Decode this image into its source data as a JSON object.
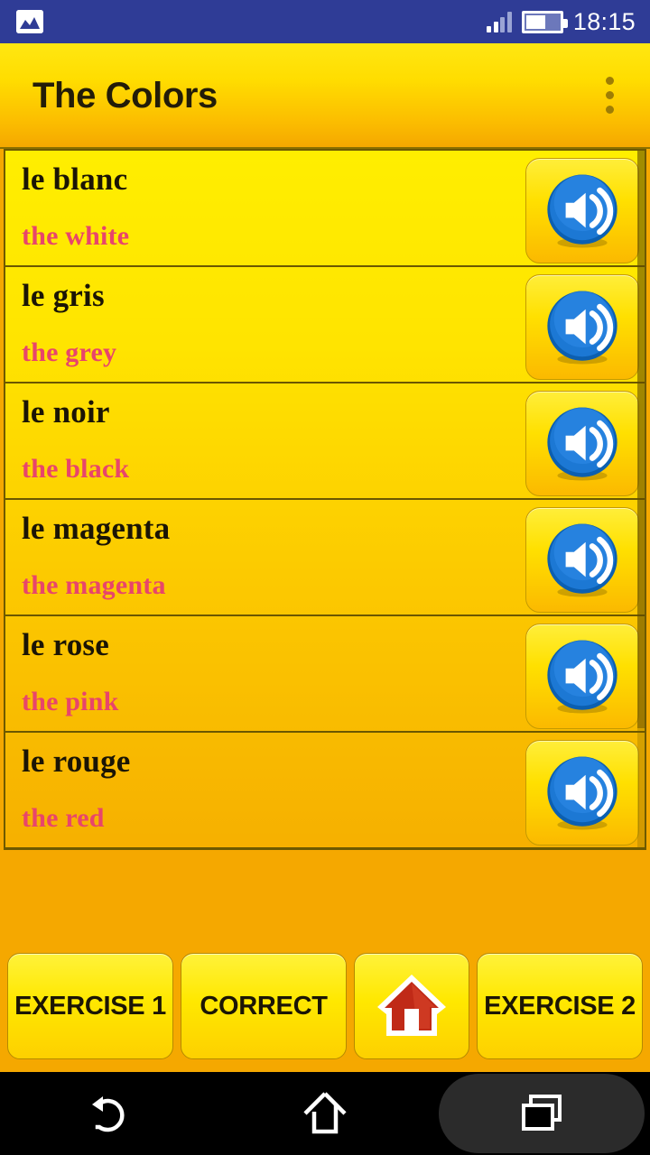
{
  "status_bar": {
    "notification_icon": "gallery-image-icon",
    "signal_icon": "signal-bars-icon",
    "signal_bars_active": 2,
    "battery_icon": "battery-icon",
    "battery_level_percent": 58,
    "time": "18:15",
    "background_color": "#2f3c96"
  },
  "app_bar": {
    "title": "The Colors",
    "overflow_icon": "more-vertical-icon",
    "background_gradient": [
      "#ffe712",
      "#f5a800"
    ],
    "title_color": "#231c08"
  },
  "list": {
    "speaker_icon": "speaker-volume-icon",
    "french_color": "#1b1505",
    "english_color": "#e8456b",
    "items": [
      {
        "french": "le blanc",
        "english": "the white"
      },
      {
        "french": "le gris",
        "english": "the grey"
      },
      {
        "french": "le noir",
        "english": "the black"
      },
      {
        "french": "le magenta",
        "english": "the magenta"
      },
      {
        "french": "le rose",
        "english": "the pink"
      },
      {
        "french": "le rouge",
        "english": "the red"
      }
    ]
  },
  "bottom_buttons": [
    {
      "label": "EXERCISE 1",
      "icon": null
    },
    {
      "label": "CORRECT",
      "icon": null
    },
    {
      "label": "",
      "icon": "home-house-icon"
    },
    {
      "label": "EXERCISE 2",
      "icon": null
    }
  ],
  "android_nav": {
    "back": "back-arrow-icon",
    "home": "home-outline-icon",
    "recents": "recents-squares-icon",
    "background_color": "#000000"
  }
}
